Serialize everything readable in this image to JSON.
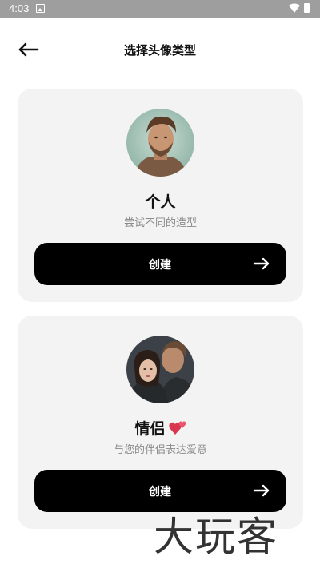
{
  "status_bar": {
    "time": "4:03"
  },
  "header": {
    "title": "选择头像类型"
  },
  "cards": [
    {
      "title": "个人",
      "subtitle": "尝试不同的造型",
      "button_label": "创建"
    },
    {
      "title": "情侣",
      "subtitle": "与您的伴侣表达爱意",
      "button_label": "创建"
    }
  ],
  "watermark": "大玩客",
  "colors": {
    "card_bg": "#f3f3f3",
    "button_bg": "#000000",
    "button_text": "#ffffff",
    "subtitle": "#8a8a8a",
    "status_bar": "#9e9e9e"
  },
  "icons": [
    "image-icon",
    "wifi-icon",
    "battery-icon",
    "back-arrow-icon",
    "right-arrow-icon",
    "two-hearts-emoji"
  ]
}
